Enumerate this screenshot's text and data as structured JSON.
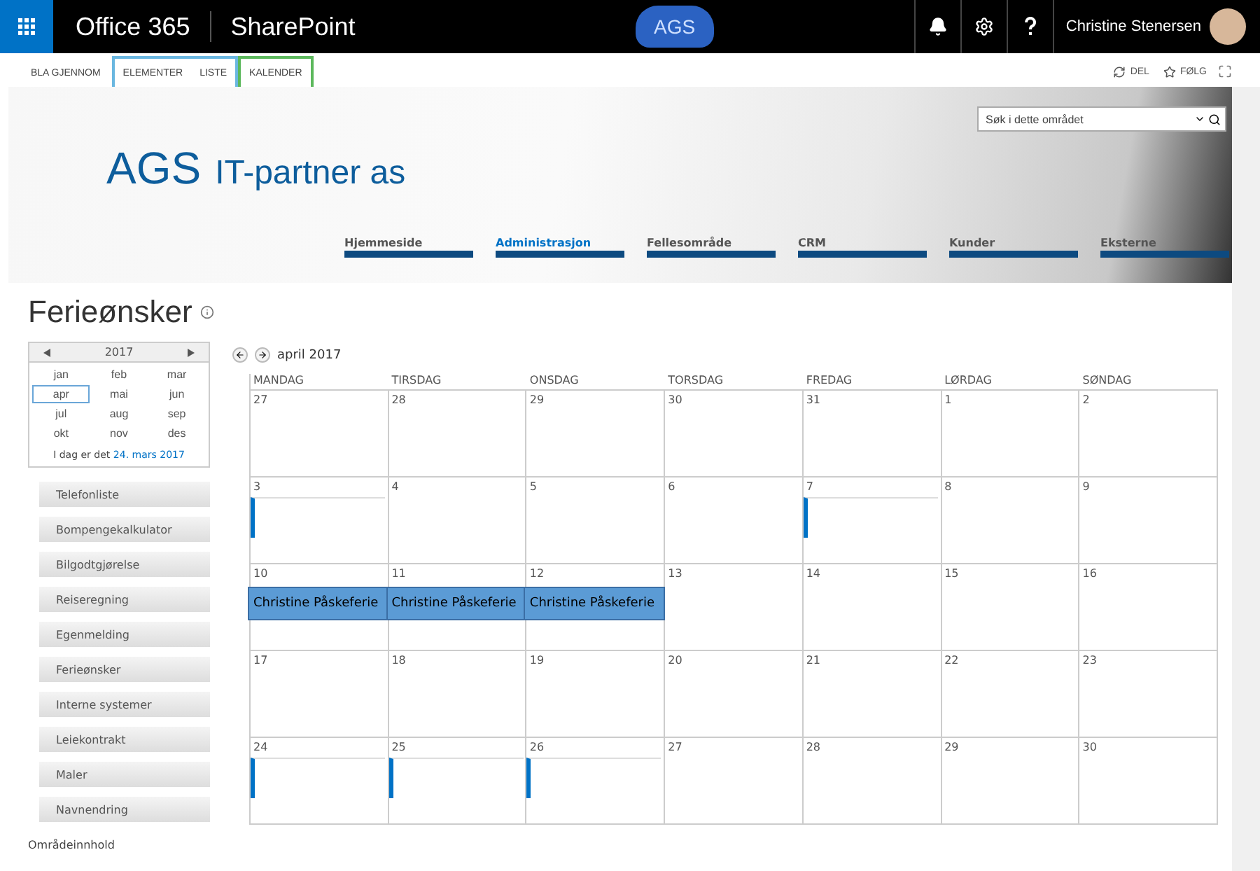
{
  "suite_bar": {
    "brand": "Office 365",
    "app": "SharePoint",
    "logo": "AGS",
    "user": "Christine Stenersen"
  },
  "ribbon": {
    "tabs": [
      {
        "label": "BLA GJENNOM",
        "selected": false,
        "kind": "plain"
      },
      {
        "label": "ELEMENTER",
        "selected": false,
        "kind": "list"
      },
      {
        "label": "LISTE",
        "selected": false,
        "kind": "list"
      },
      {
        "label": "KALENDER",
        "selected": false,
        "kind": "calendar"
      }
    ],
    "actions": [
      {
        "label": "DEL",
        "kind": "share"
      },
      {
        "label": "FØLG",
        "kind": "follow"
      }
    ]
  },
  "search": {
    "placeholder": "Søk i dette området"
  },
  "site": {
    "logo": "AGS",
    "name": "IT-partner as"
  },
  "top_nav": [
    {
      "label": "Hjemmeside",
      "selected": false
    },
    {
      "label": "Administrasjon",
      "selected": true
    },
    {
      "label": "Fellesområde",
      "selected": false
    },
    {
      "label": "CRM",
      "selected": false
    },
    {
      "label": "Kunder",
      "selected": false
    },
    {
      "label": "Eksterne",
      "selected": false
    }
  ],
  "page_title": "Ferieønsker",
  "month_picker": {
    "year": "2017",
    "months": [
      {
        "label": "jan",
        "selected": false
      },
      {
        "label": "feb",
        "selected": false
      },
      {
        "label": "mar",
        "selected": false
      },
      {
        "label": "apr",
        "selected": true
      },
      {
        "label": "mai",
        "selected": false
      },
      {
        "label": "jun",
        "selected": false
      },
      {
        "label": "jul",
        "selected": false
      },
      {
        "label": "aug",
        "selected": false
      },
      {
        "label": "sep",
        "selected": false
      },
      {
        "label": "okt",
        "selected": false
      },
      {
        "label": "nov",
        "selected": false
      },
      {
        "label": "des",
        "selected": false
      }
    ],
    "today_prefix": "I dag er det",
    "today_link": "24. mars 2017"
  },
  "quick_launch": [
    "Telefonliste",
    "Bompengekalkulator",
    "Bilgodtgjørelse",
    "Reiseregning",
    "Egenmelding",
    "Ferieønsker",
    "Interne systemer",
    "Leiekontrakt",
    "Maler",
    "Navnendring"
  ],
  "site_contents": "Områdeinnhold",
  "calendar": {
    "month": "april 2017",
    "weekdays": [
      "MANDAG",
      "TIRSDAG",
      "ONSDAG",
      "TORSDAG",
      "FREDAG",
      "LØRDAG",
      "SØNDAG"
    ],
    "weeks": [
      [
        {
          "day": "27",
          "marker": false
        },
        {
          "day": "28",
          "marker": false
        },
        {
          "day": "29",
          "marker": false
        },
        {
          "day": "30",
          "marker": false
        },
        {
          "day": "31",
          "marker": false
        },
        {
          "day": "1",
          "marker": false
        },
        {
          "day": "2",
          "marker": false
        }
      ],
      [
        {
          "day": "3",
          "marker": true
        },
        {
          "day": "4",
          "marker": false
        },
        {
          "day": "5",
          "marker": false
        },
        {
          "day": "6",
          "marker": false
        },
        {
          "day": "7",
          "marker": true
        },
        {
          "day": "8",
          "marker": false
        },
        {
          "day": "9",
          "marker": false
        }
      ],
      [
        {
          "day": "10",
          "marker": false,
          "event": "Christine Påskeferie"
        },
        {
          "day": "11",
          "marker": false,
          "event": "Christine Påskeferie"
        },
        {
          "day": "12",
          "marker": false,
          "event": "Christine Påskeferie"
        },
        {
          "day": "13",
          "marker": false
        },
        {
          "day": "14",
          "marker": false
        },
        {
          "day": "15",
          "marker": false
        },
        {
          "day": "16",
          "marker": false
        }
      ],
      [
        {
          "day": "17",
          "marker": false
        },
        {
          "day": "18",
          "marker": false
        },
        {
          "day": "19",
          "marker": false
        },
        {
          "day": "20",
          "marker": false
        },
        {
          "day": "21",
          "marker": false
        },
        {
          "day": "22",
          "marker": false
        },
        {
          "day": "23",
          "marker": false
        }
      ],
      [
        {
          "day": "24",
          "marker": true
        },
        {
          "day": "25",
          "marker": true
        },
        {
          "day": "26",
          "marker": true
        },
        {
          "day": "27",
          "marker": false
        },
        {
          "day": "28",
          "marker": false
        },
        {
          "day": "29",
          "marker": false
        },
        {
          "day": "30",
          "marker": false
        }
      ]
    ]
  }
}
